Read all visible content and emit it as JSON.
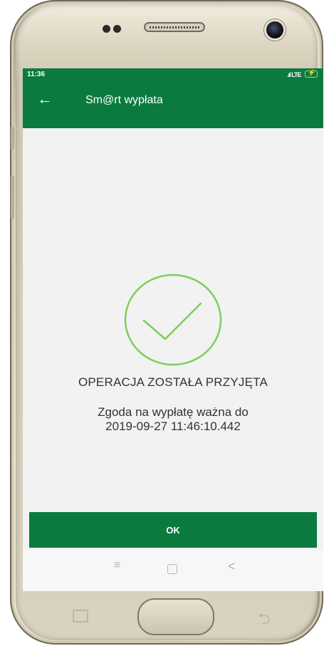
{
  "status_bar": {
    "time": "11:36",
    "signal": ".ıl LTE"
  },
  "app_bar": {
    "title": "Sm@rt wypłata",
    "back_icon": "arrow-left-icon"
  },
  "result": {
    "icon": "check-circle-icon",
    "title": "OPERACJA ZOSTAŁA PRZYJĘTA",
    "line1": "Zgoda na wypłatę ważna do",
    "line2": "2019-09-27 11:46:10.442"
  },
  "button": {
    "ok_label": "OK"
  },
  "nav_bar": {
    "recent": "≡",
    "back": "<"
  },
  "colors": {
    "primary": "#0a7a3f",
    "check": "#7ccf5a",
    "background": "#f2f2f2"
  }
}
